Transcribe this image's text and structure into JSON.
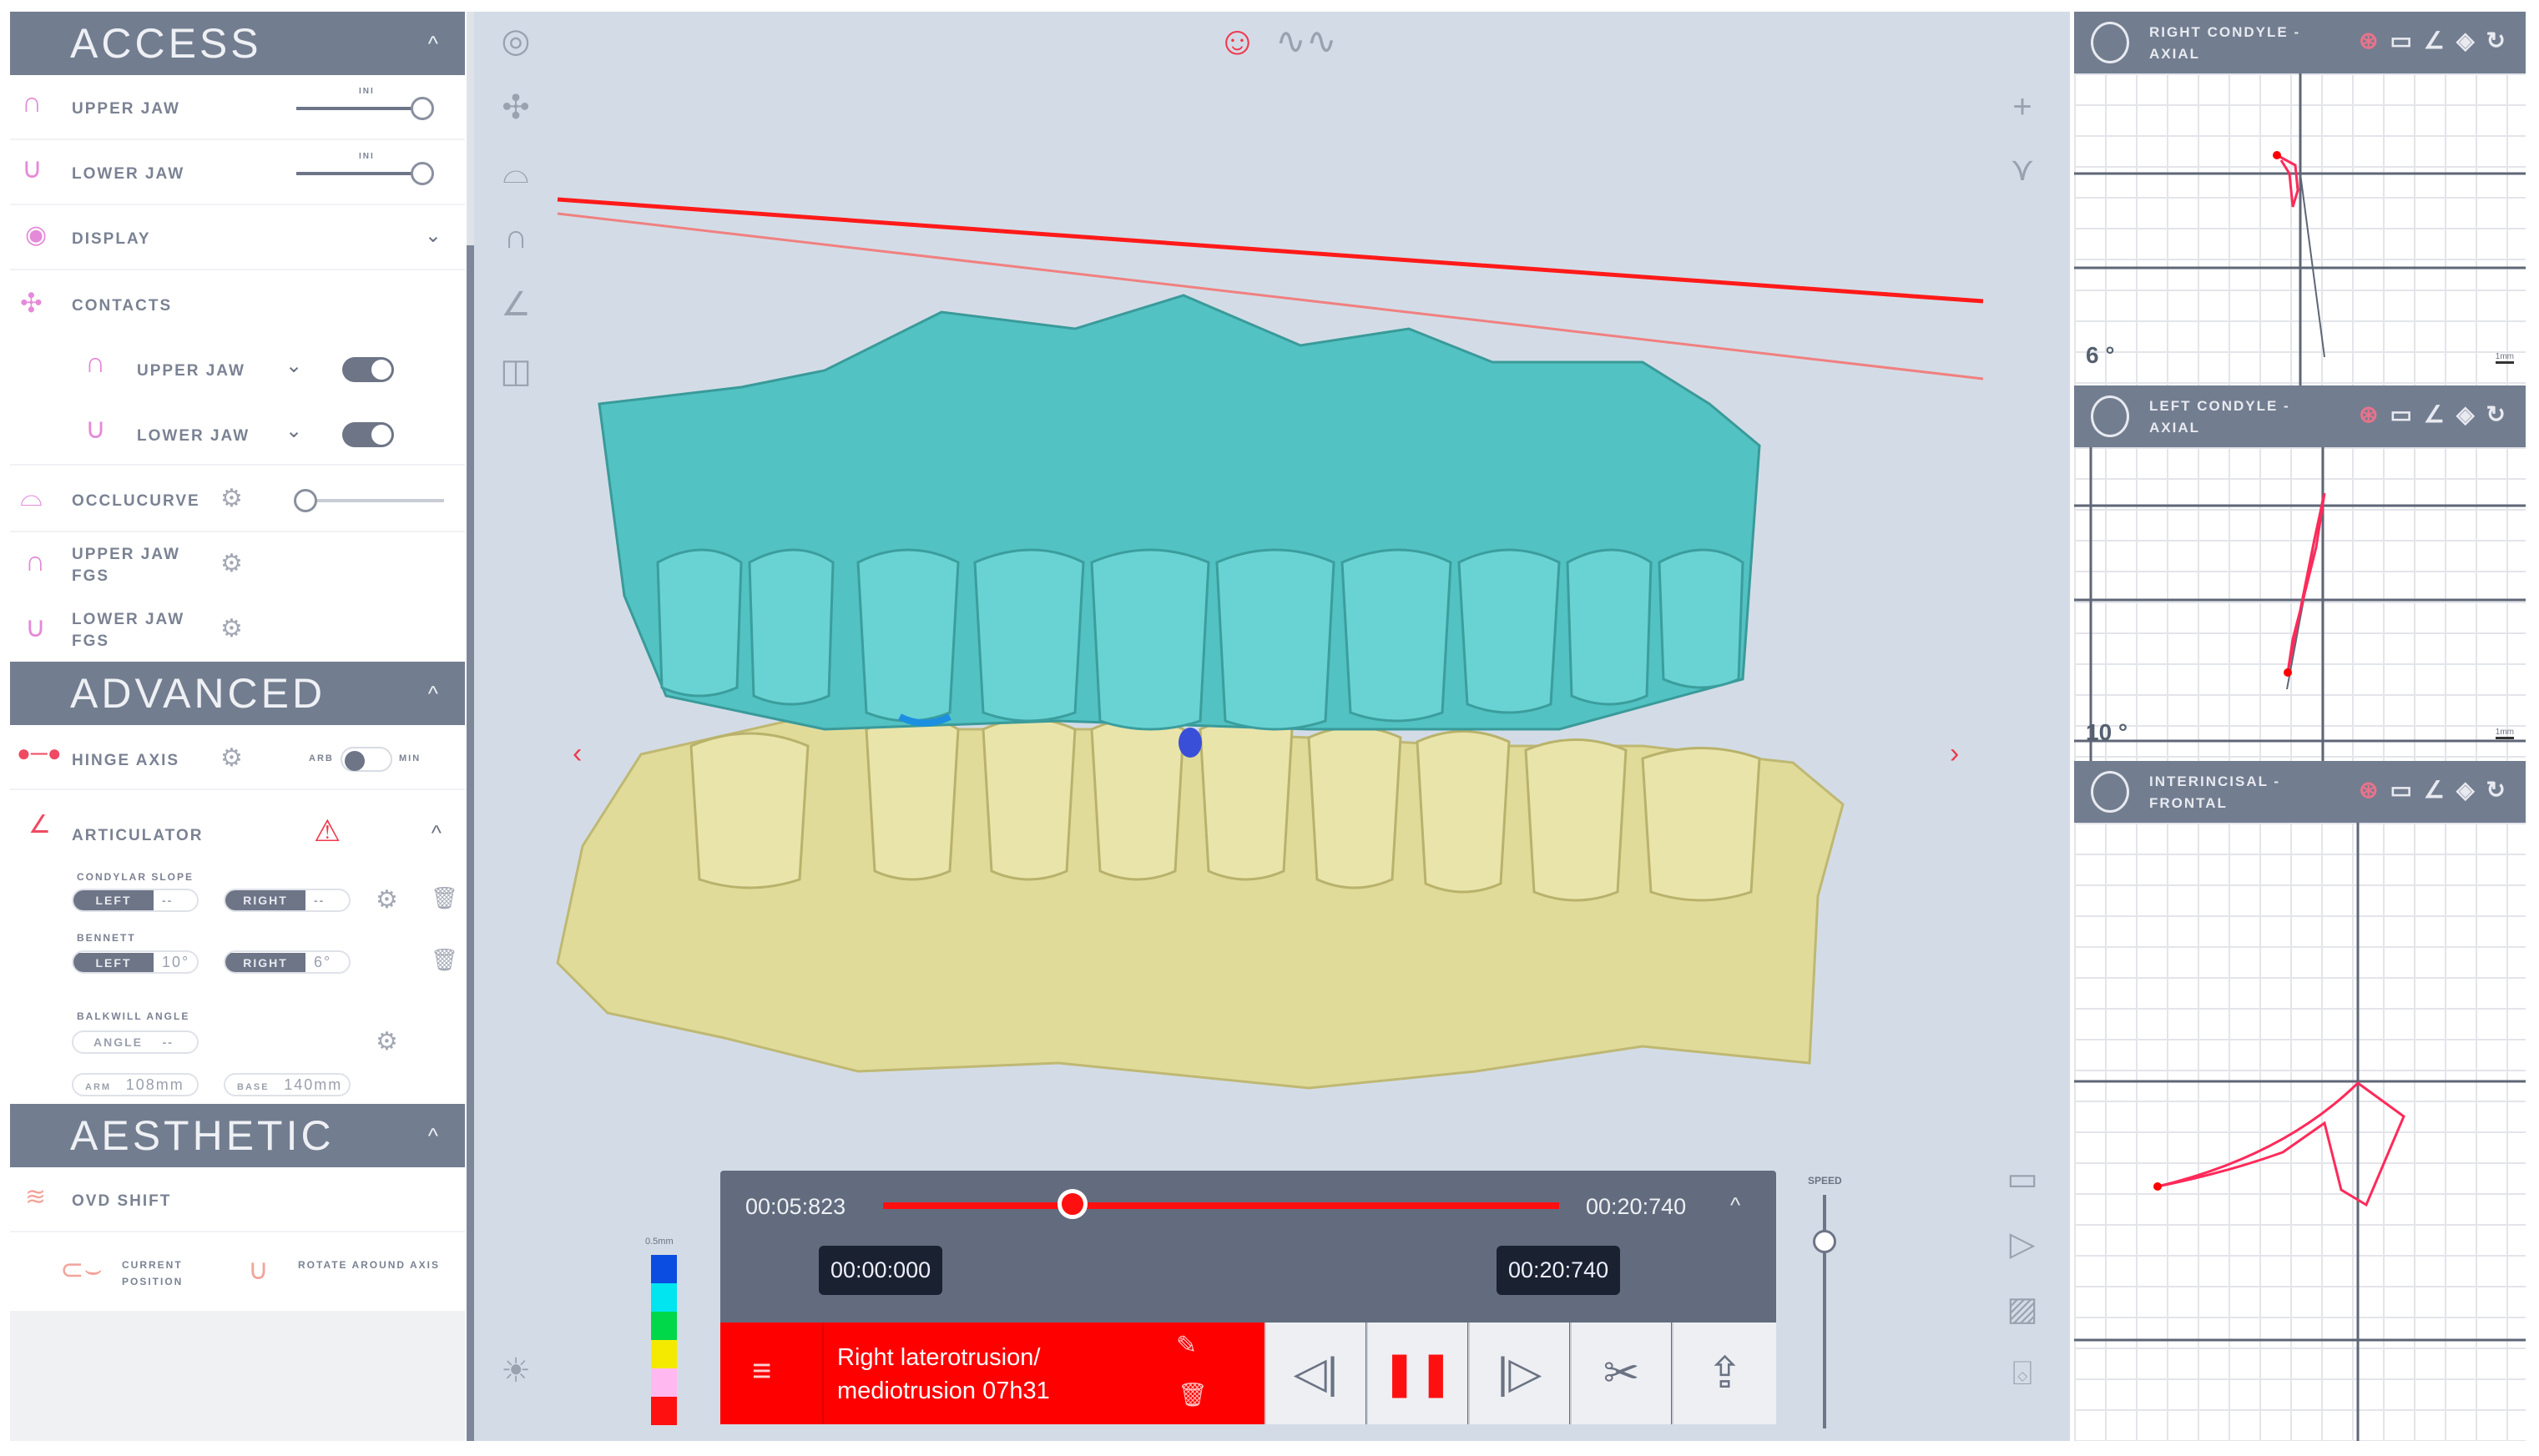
{
  "access": {
    "title": "ACCESS",
    "upper_jaw": "UPPER JAW",
    "lower_jaw": "LOWER JAW",
    "ini": "INI",
    "display": "DISPLAY",
    "contacts": "CONTACTS",
    "contacts_upper": "UPPER JAW",
    "contacts_lower": "LOWER JAW",
    "occlucurve": "OCCLUCURVE",
    "upper_fgs": "UPPER JAW FGS",
    "lower_fgs": "LOWER JAW FGS"
  },
  "advanced": {
    "title": "ADVANCED",
    "hinge_axis": "HINGE AXIS",
    "arb": "ARB",
    "min": "MIN",
    "articulator": "ARTICULATOR",
    "condylar_slope": "CONDYLAR SLOPE",
    "left": "LEFT",
    "right": "RIGHT",
    "cs_left_val": "--",
    "cs_right_val": "--",
    "bennett": "BENNETT",
    "bennett_left_val": "10°",
    "bennett_right_val": "6°",
    "balkwill": "BALKWILL ANGLE",
    "angle": "ANGLE",
    "angle_val": "--",
    "arm": "ARM",
    "arm_val": "108mm",
    "base": "BASE",
    "base_val": "140mm"
  },
  "aesthetic": {
    "title": "AESTHETIC",
    "ovd_shift": "OVD SHIFT",
    "current_position": "CURRENT POSITION",
    "rotate_around_axis": "ROTATE AROUND AXIS"
  },
  "graphs": [
    {
      "title": "RIGHT CONDYLE - AXIAL",
      "angle": "6 °",
      "scale": "1mm"
    },
    {
      "title": "LEFT CONDYLE - AXIAL",
      "angle": "10 °",
      "scale": "1mm"
    },
    {
      "title": "INTERINCISAL - FRONTAL"
    }
  ],
  "timeline": {
    "current": "00:05:823",
    "end": "00:20:740",
    "marker_start": "00:00:000",
    "marker_end": "00:20:740",
    "progress": 0.28,
    "recording": "Right laterotrusion/ mediotrusion 07h31",
    "speed_label": "SPEED",
    "speed": 0.8
  },
  "legend": {
    "label": "0.5mm",
    "colors": [
      "#0b4de0",
      "#00e5f0",
      "#00d84a",
      "#f4ea00",
      "#ffb8f0",
      "#ff1010"
    ]
  },
  "colors": {
    "accent": "#ff0000",
    "header": "#727d90",
    "upper_jaw": "#5cc9c9",
    "lower_jaw": "#e4dea0"
  }
}
